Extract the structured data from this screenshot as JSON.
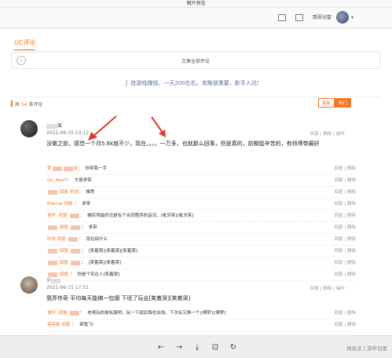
{
  "window": {
    "title": "图片预览"
  },
  "header": {
    "user_name": "瓢翠创富",
    "caret": "▾"
  },
  "tabs": {
    "uc_comments": "UC评论"
  },
  "article": {
    "back_icon": "‹",
    "title": "文章全部评论",
    "quote": "挂游戏赚钱，一天200左右，攻略很重要，新手入坑!"
  },
  "comments_header": {
    "prefix": "共",
    "count": "54",
    "suffix": "条评论",
    "sort_newest": "最新",
    "sort_hot": "热门"
  },
  "comment1": {
    "user_suffix": "某",
    "time": "2021-06-15 23:12",
    "text": "没做之前，感觉一个月5.6k就不少，现在。。。。一万多，也就那么回事，但是真的，前期挺辛苦的，有师傅带最好",
    "reply": "回复",
    "delete": "删除",
    "more": "操作"
  },
  "replies": [
    {
      "user": "梦",
      "blur_mid": true,
      "reply_to": "友",
      "text": "你带我一手"
    },
    {
      "user": "Go_AwaY",
      "reply_tag": "回复",
      "text": "大佬求带"
    },
    {
      "user": "",
      "reply_tag": "回复",
      "text": "推荐",
      "to_name": "听说"
    },
    {
      "user": "Eternal",
      "reply_tag": "回复",
      "text": "求带"
    },
    {
      "user": "诡坏·",
      "reply_tag": "回复",
      "text": "确实得最好还是有个合同程序的话况，[呲牙笑][呲牙笑]"
    },
    {
      "user": "",
      "reply_tag": "回复",
      "text": "求带"
    },
    {
      "user": "听说",
      "reply_tag": "回复",
      "text": "现在搞什么"
    },
    {
      "user": "",
      "reply_tag": "回复",
      "text": "[笑着哭][笑着哭][笑着哭]"
    },
    {
      "user": "",
      "reply_tag": "回复",
      "text": "[笑着哭][笑着哭]"
    },
    {
      "user": "",
      "reply_tag": "回复",
      "text": "你是个实在人[笑着哭]"
    }
  ],
  "reply_actions": {
    "reply": "回复",
    "delete": "删除"
  },
  "comment2": {
    "user_prefix": "少",
    "time": "2021-06-15 17:51",
    "text": "我弄传奇 平均每天能搞一包烟 下班了玩会[笑着哭][笑着哭]",
    "reply": "回复",
    "delete": "删除",
    "more": "操作"
  },
  "replies2": [
    {
      "user": "诡坏·",
      "reply_tag": "回复",
      "text": "老哥玩的是私服吧，玩一下就后悔也出钱，下次玩又换一个{傅梦}[傅梦]"
    },
    {
      "user": "亮亮帆",
      "reply_tag": "回复",
      "text": "带我飞!"
    }
  ],
  "bottombar": {
    "prev": "←",
    "next": "→",
    "download": "⤓",
    "crop": "⊡",
    "rotate": "↻",
    "watermark": "网侃总 | 游牢创富"
  }
}
